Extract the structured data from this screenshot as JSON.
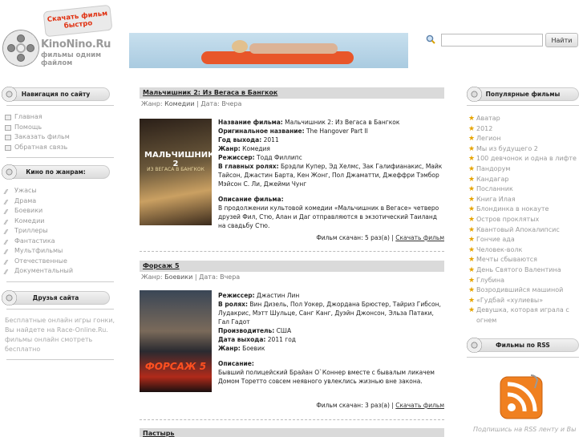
{
  "header": {
    "logo_badge": "Скачать фильм быстро",
    "logo_name": "KinoNino.Ru",
    "logo_tagline": "фильмы одним файлом",
    "search_placeholder": "",
    "search_button": "Найти"
  },
  "left": {
    "nav_title": "Навигация по сайту",
    "nav_items": [
      "Главная",
      "Помощь",
      "Заказать фильм",
      "Обратная связь"
    ],
    "genres_title": "Кино по жанрам:",
    "genres": [
      "Ужасы",
      "Драма",
      "Боевики",
      "Комедии",
      "Триллеры",
      "Фантастика",
      "Мультфильмы",
      "Отечественные",
      "Документальный"
    ],
    "friends_title": "Друзья сайта",
    "friends_text": "Бесплатные онлайн игры гонки, Вы найдете на Race-Online.Ru. фильмы онлайн смотреть бесплатно"
  },
  "posts": [
    {
      "title": "Мальчишник 2: Из Вегаса в Бангкок",
      "genre_label": "Жанр:",
      "genre": "Комедии",
      "date_label": "Дата:",
      "date": "Вчера",
      "poster_title": "МАЛЬЧИШНИК 2",
      "poster_subtitle": "ИЗ ВЕГАСА В БАНГКОК",
      "lines": [
        {
          "k": "Название фильма:",
          "v": " Мальчишник 2: Из Вегаса в Бангкок"
        },
        {
          "k": "Оригинальное название:",
          "v": " The Hangover Part II"
        },
        {
          "k": "Год выхода:",
          "v": " 2011"
        },
        {
          "k": "Жанр:",
          "v": " Комедия"
        },
        {
          "k": "Режиссер:",
          "v": " Тодд Филлипс"
        },
        {
          "k": "В главных ролях:",
          "v": " Брэдли Купер, Эд Хелмс, Зак Галифианакис, Майк Тайсон, Джастин Барта, Кен Жонг, Пол Джаматти, Джеффри Тэмбор Мэйсон С. Ли, Джейми Чунг"
        }
      ],
      "desc_label": "Описание фильма:",
      "desc": "В продолжении культовой комедии «Мальчишник в Вегасе» четверо друзей Фил, Стю, Алан и Даг отправляются в экзотический Таиланд на свадьбу Стю.",
      "downloads": "Фильм скачан: 5 раз(а)",
      "download_link": "Скачать фильм"
    },
    {
      "title": "Форсаж 5",
      "genre_label": "Жанр:",
      "genre": "Боевики",
      "date_label": "Дата:",
      "date": "Вчера",
      "poster_title": "ФОРСАЖ 5",
      "poster_subtitle": "",
      "lines": [
        {
          "k": "Режиссер:",
          "v": " Джастин Лин"
        },
        {
          "k": "В ролях:",
          "v": " Вин Дизель, Пол Уокер, Джордана Брюстер, Тайриз Гибсон, Лудакрис, Мэтт Шульце, Санг Канг, Дуэйн Джонсон, Эльза Патаки, Гал Гадот"
        },
        {
          "k": "Производитель:",
          "v": " США"
        },
        {
          "k": "Дата выхода:",
          "v": " 2011 год"
        },
        {
          "k": "Жанр:",
          "v": " Боевик"
        }
      ],
      "desc_label": "Описание:",
      "desc": "Бывший полицейский Брайан О`Коннер вместе с бывалым ликачем Домом Торетто совсем неявного увлеклись жизнью вне закона.",
      "downloads": "Фильм скачан: 3 раз(а)",
      "download_link": "Скачать фильм"
    },
    {
      "title": "Пастырь"
    }
  ],
  "right": {
    "popular_title": "Популярные фильмы",
    "popular": [
      "Аватар",
      "2012",
      "Легион",
      "Мы из будущего 2",
      "100 девчонок и одна в лифте",
      "Пандорум",
      "Кандагар",
      "Посланник",
      "Книга Илая",
      "Блондинка в нокауте",
      "Остров проклятых",
      "Квантовый Апокалипсис",
      "Гончие ада",
      "Человек-волк",
      "Мечты сбываются",
      "День Святого Валентина",
      "Глубина",
      "Возродившийся машиной",
      "«Гудбай «хулиевы»",
      "Девушка, которая играла с огнем"
    ],
    "rss_title": "Фильмы по RSS",
    "rss_text": "Подпишись на RSS ленту и Вы"
  },
  "colors": {
    "accent": "#e03010",
    "star": "#e6a400",
    "rss": "#f08020"
  }
}
